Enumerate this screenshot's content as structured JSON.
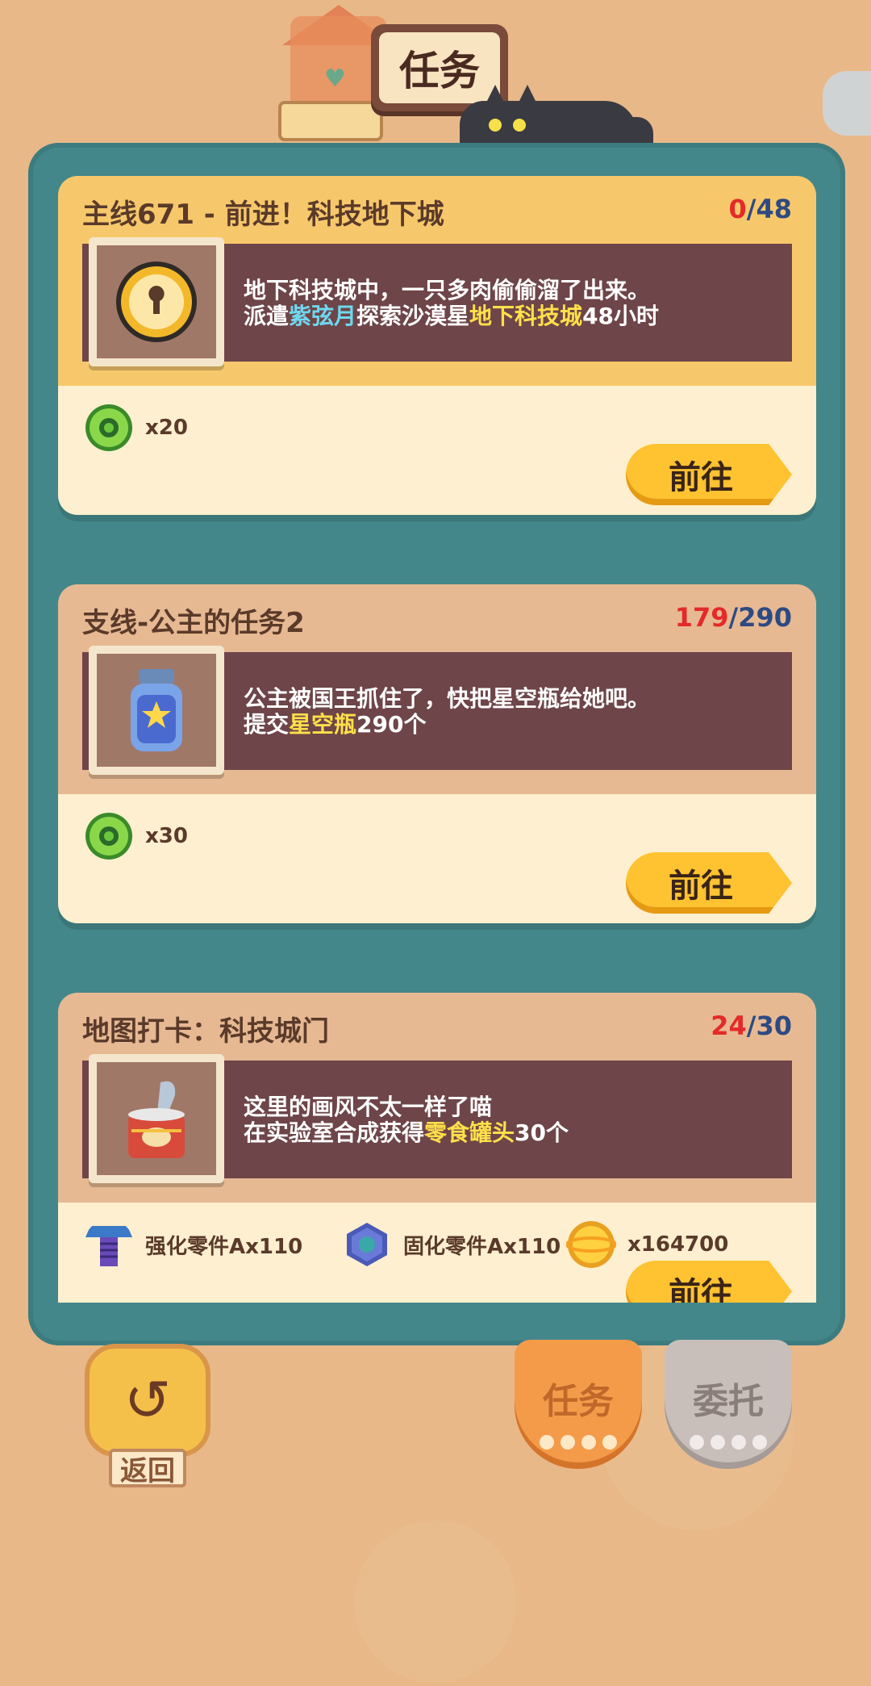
{
  "header": {
    "title": "任务"
  },
  "quests": [
    {
      "title": "主线671 - 前进！科技地下城",
      "progress_current": "0",
      "progress_sep": "/",
      "progress_max": "48",
      "desc_line1": "地下科技城中，一只多肉偷偷溜了出来。",
      "desc_line2_parts": [
        "派遣",
        "紫弦月",
        "探索沙漠星",
        "地下科技城",
        "48小时"
      ],
      "icon": "clock-coin-icon",
      "rewards": [
        {
          "icon": "green-donut-icon",
          "text": "x20"
        }
      ],
      "button": "前往"
    },
    {
      "title": "支线-公主的任务2",
      "progress_current": "179",
      "progress_sep": "/",
      "progress_max": "290",
      "desc_line1": "公主被国王抓住了，快把星空瓶给她吧。",
      "desc_line2_parts": [
        "提交",
        "星空瓶",
        "290个"
      ],
      "icon": "star-jar-icon",
      "rewards": [
        {
          "icon": "green-donut-icon",
          "text": "x30"
        }
      ],
      "button": "前往"
    },
    {
      "title": "地图打卡：科技城门",
      "progress_current": "24",
      "progress_sep": "/",
      "progress_max": "30",
      "desc_line1": "这里的画风不太一样了喵",
      "desc_line2_parts": [
        "在实验室合成获得",
        "零食罐头",
        "30个"
      ],
      "icon": "snack-can-icon",
      "rewards": [
        {
          "icon": "blue-bolt-icon",
          "text": "强化零件Ax110"
        },
        {
          "icon": "hex-nut-icon",
          "text": "固化零件Ax110"
        },
        {
          "icon": "gold-coin-icon",
          "text": "x164700"
        }
      ],
      "button": "前往"
    }
  ],
  "footer": {
    "back_label": "返回",
    "tab_tasks": "任务",
    "tab_commission": "委托"
  },
  "colors": {
    "background": "#e8b888",
    "panel": "#44878a",
    "progress_current": "#e42a2a",
    "progress_max": "#2d4a82",
    "highlight_blue": "#6fd8f0",
    "highlight_yellow": "#ffe04a",
    "button": "#ffc230"
  }
}
